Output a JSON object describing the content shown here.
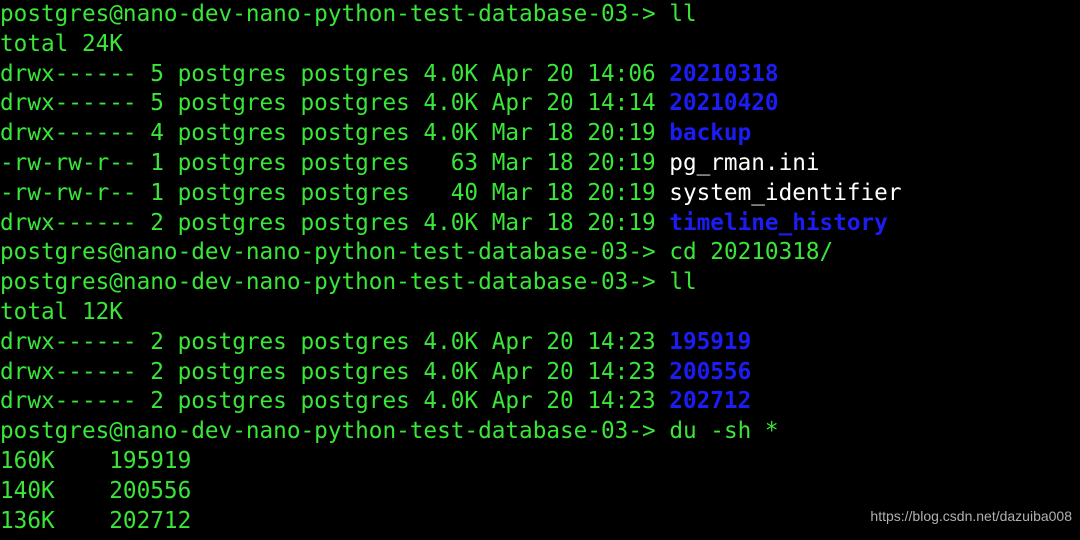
{
  "colors": {
    "background": "#000000",
    "text": "#39e639",
    "directory": "#1c1cf5",
    "plain_file": "#ffffff"
  },
  "terminal": {
    "prompt": "postgres@nano-dev-nano-python-test-database-03->",
    "lines": [
      {
        "kind": "command",
        "command": "ll"
      },
      {
        "kind": "text",
        "text": "total 24K"
      },
      {
        "kind": "entry",
        "meta": "drwx------ 5 postgres postgres 4.0K Apr 20 14:06 ",
        "name": "20210318",
        "type": "dir"
      },
      {
        "kind": "entry",
        "meta": "drwx------ 5 postgres postgres 4.0K Apr 20 14:14 ",
        "name": "20210420",
        "type": "dir"
      },
      {
        "kind": "entry",
        "meta": "drwx------ 4 postgres postgres 4.0K Mar 18 20:19 ",
        "name": "backup",
        "type": "dir"
      },
      {
        "kind": "entry",
        "meta": "-rw-rw-r-- 1 postgres postgres   63 Mar 18 20:19 ",
        "name": "pg_rman.ini",
        "type": "file"
      },
      {
        "kind": "entry",
        "meta": "-rw-rw-r-- 1 postgres postgres   40 Mar 18 20:19 ",
        "name": "system_identifier",
        "type": "file"
      },
      {
        "kind": "entry",
        "meta": "drwx------ 2 postgres postgres 4.0K Mar 18 20:19 ",
        "name": "timeline_history",
        "type": "dir"
      },
      {
        "kind": "command",
        "command": "cd 20210318/"
      },
      {
        "kind": "command",
        "command": "ll"
      },
      {
        "kind": "text",
        "text": "total 12K"
      },
      {
        "kind": "entry",
        "meta": "drwx------ 2 postgres postgres 4.0K Apr 20 14:23 ",
        "name": "195919",
        "type": "dir"
      },
      {
        "kind": "entry",
        "meta": "drwx------ 2 postgres postgres 4.0K Apr 20 14:23 ",
        "name": "200556",
        "type": "dir"
      },
      {
        "kind": "entry",
        "meta": "drwx------ 2 postgres postgres 4.0K Apr 20 14:23 ",
        "name": "202712",
        "type": "dir"
      },
      {
        "kind": "command",
        "command": "du -sh *"
      },
      {
        "kind": "text",
        "text": "160K    195919"
      },
      {
        "kind": "text",
        "text": "140K    200556"
      },
      {
        "kind": "text",
        "text": "136K    202712"
      }
    ]
  },
  "watermark": "https://blog.csdn.net/dazuiba008"
}
